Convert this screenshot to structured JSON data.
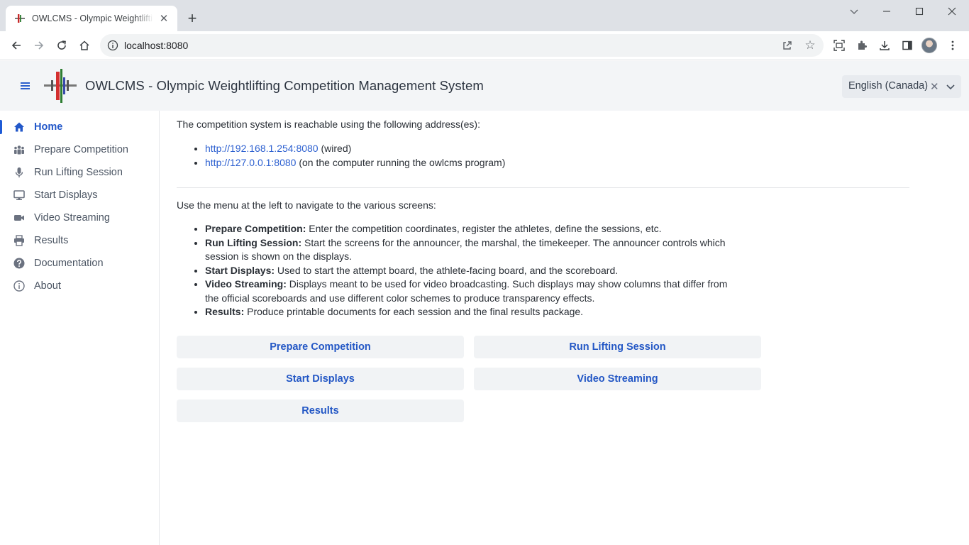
{
  "browser": {
    "tab_title": "OWLCMS - Olympic Weightlifting Competition Management System",
    "url": "localhost:8080"
  },
  "header": {
    "title": "OWLCMS - Olympic Weightlifting Competition Management System",
    "language": "English (Canada)"
  },
  "sidebar": {
    "items": [
      {
        "label": "Home",
        "icon": "home-icon"
      },
      {
        "label": "Prepare Competition",
        "icon": "users-icon"
      },
      {
        "label": "Run Lifting Session",
        "icon": "microphone-icon"
      },
      {
        "label": "Start Displays",
        "icon": "desktop-icon"
      },
      {
        "label": "Video Streaming",
        "icon": "video-camera-icon"
      },
      {
        "label": "Results",
        "icon": "printer-icon"
      },
      {
        "label": "Documentation",
        "icon": "question-icon"
      },
      {
        "label": "About",
        "icon": "info-icon"
      }
    ]
  },
  "main": {
    "reach_intro": "The competition system is reachable using the following address(es):",
    "addresses": [
      {
        "url": "http://192.168.1.254:8080",
        "note": " (wired)"
      },
      {
        "url": "http://127.0.0.1:8080",
        "note": " (on the computer running the owlcms program)"
      }
    ],
    "menu_intro": "Use the menu at the left to navigate to the various screens:",
    "descriptions": [
      {
        "term": "Prepare Competition:",
        "text": " Enter the competition coordinates, register the athletes, define the sessions, etc."
      },
      {
        "term": "Run Lifting Session:",
        "text": " Start the screens for the announcer, the marshal, the timekeeper. The announcer controls which session is shown on the displays."
      },
      {
        "term": "Start Displays:",
        "text": " Used to start the attempt board, the athlete-facing board, and the scoreboard."
      },
      {
        "term": "Video Streaming:",
        "text": " Displays meant to be used for video broadcasting. Such displays may show columns that differ from the official scoreboards and use different color schemes to produce transparency effects."
      },
      {
        "term": "Results:",
        "text": " Produce printable documents for each session and the final results package."
      }
    ],
    "buttons": {
      "prepare": "Prepare Competition",
      "run": "Run Lifting Session",
      "displays": "Start Displays",
      "video": "Video Streaming",
      "results": "Results"
    }
  },
  "colors": {
    "accent": "#2358c9",
    "header_bg": "#f3f5f7",
    "button_bg": "#f1f3f5"
  }
}
